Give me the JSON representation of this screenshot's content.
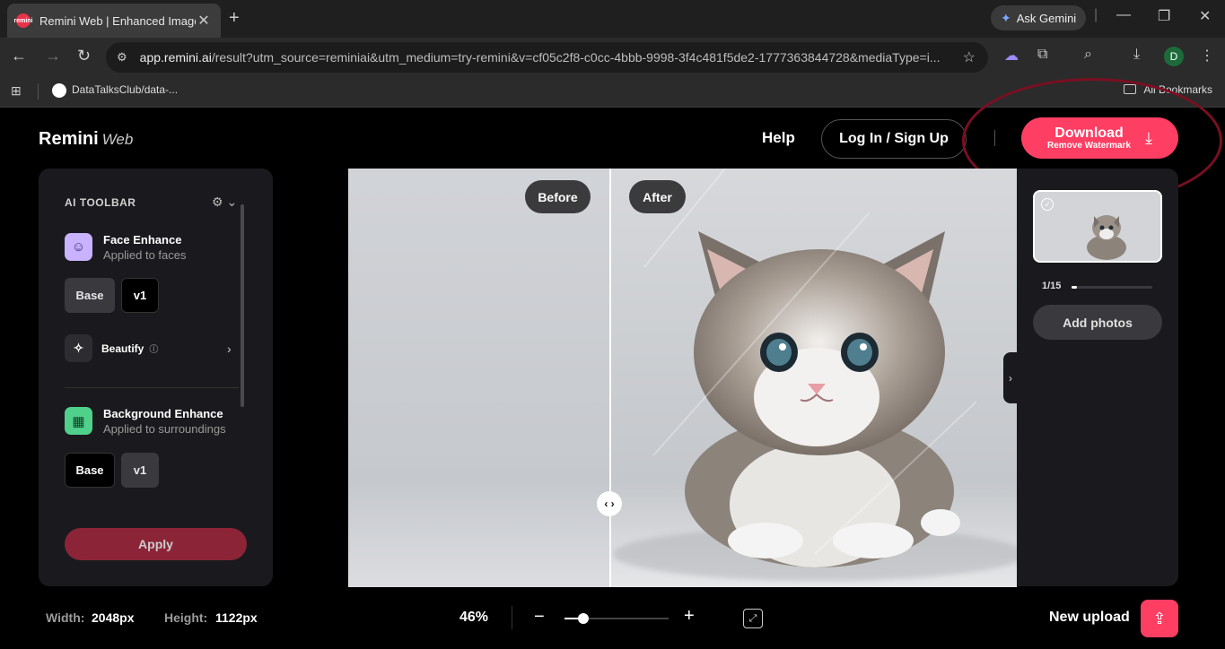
{
  "browser": {
    "tab_title": "Remini Web | Enhanced Image",
    "tab_favicon_text": "remini",
    "tab_close": "✕",
    "new_tab": "+",
    "ask_gemini": "Ask Gemini",
    "url_domain": "app.remini.ai",
    "url_rest": "/result?utm_source=reminiai&utm_medium=try-remini&v=cf05c2f8-c0cc-4bbb-9998-3f4c481f5de2-1777363844728&mediaType=i...",
    "profile_initial": "D",
    "bookmark_label": "DataTalksClub/data-...",
    "all_bookmarks": "All Bookmarks"
  },
  "header": {
    "logo": "Remini",
    "logo_sub": "Web",
    "help": "Help",
    "login": "Log In / Sign Up",
    "download": "Download",
    "download_sub": "Remove Watermark"
  },
  "toolbar": {
    "title": "AI TOOLBAR",
    "face": {
      "title": "Face Enhance",
      "subtitle": "Applied to faces",
      "opt1": "Base",
      "opt2": "v1"
    },
    "beautify": "Beautify",
    "background": {
      "title": "Background Enhance",
      "subtitle": "Applied to surroundings",
      "opt1": "Base",
      "opt2": "v1"
    },
    "apply": "Apply"
  },
  "compare": {
    "before": "Before",
    "after": "After",
    "watermark": "Remini"
  },
  "sidebar": {
    "counter": "1/15",
    "progress": 0.07,
    "add_photos": "Add photos"
  },
  "footer": {
    "width_label": "Width:",
    "width_value": "2048px",
    "height_label": "Height:",
    "height_value": "1122px",
    "zoom": "46%",
    "zoom_level": 0.18,
    "new_upload": "New upload"
  },
  "colors": {
    "accent": "#ff3e63",
    "annotation": "#7a0f22"
  }
}
